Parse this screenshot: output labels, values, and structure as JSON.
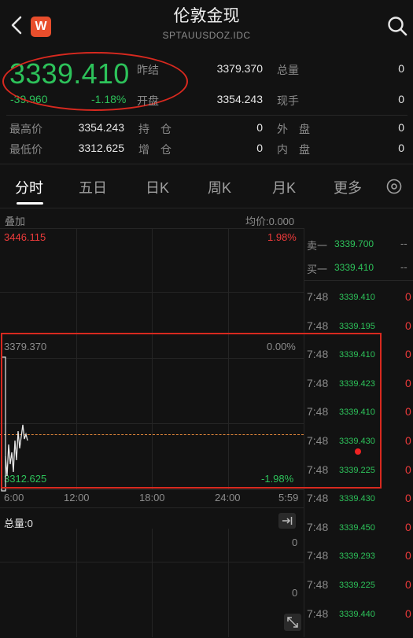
{
  "header": {
    "title": "伦敦金现",
    "subtitle": "SPTAUUSDOZ.IDC",
    "logo_letter": "W"
  },
  "quote": {
    "price": "3339.410",
    "change": "-39.960",
    "change_pct": "-1.18%",
    "fields": [
      {
        "label": "昨结",
        "value": "3379.370"
      },
      {
        "label": "总量",
        "value": "0"
      },
      {
        "label": "开盘",
        "value": "3354.243"
      },
      {
        "label": "现手",
        "value": "0"
      },
      {
        "label": "最高价",
        "value": "3354.243"
      },
      {
        "label": "持　仓",
        "value": "0"
      },
      {
        "label": "外　盘",
        "value": "0"
      },
      {
        "label": "最低价",
        "value": "3312.625"
      },
      {
        "label": "增　仓",
        "value": "0"
      },
      {
        "label": "内　盘",
        "value": "0"
      }
    ]
  },
  "tabs": [
    "分时",
    "五日",
    "日K",
    "周K",
    "月K",
    "更多"
  ],
  "chart": {
    "overlay_label": "叠加",
    "avg_label": "均价:0.000",
    "high": "3446.115",
    "high_pct": "1.98%",
    "ref": "3379.370",
    "ref_pct": "0.00%",
    "low": "3312.625",
    "low_pct": "-1.98%",
    "times": [
      "6:00",
      "12:00",
      "18:00",
      "24:00",
      "5:59"
    ],
    "volume_label": "总量:0",
    "vol_max": "0",
    "vol_min": "0"
  },
  "orderbook": {
    "sell_label": "卖一",
    "sell_price": "3339.700",
    "sell_vol": "--",
    "buy_label": "买一",
    "buy_price": "3339.410",
    "buy_vol": "--"
  },
  "trades": [
    {
      "time": "7:48",
      "price": "3339.410",
      "vol": "0"
    },
    {
      "time": "7:48",
      "price": "3339.195",
      "vol": "0"
    },
    {
      "time": "7:48",
      "price": "3339.410",
      "vol": "0"
    },
    {
      "time": "7:48",
      "price": "3339.423",
      "vol": "0"
    },
    {
      "time": "7:48",
      "price": "3339.410",
      "vol": "0"
    },
    {
      "time": "7:48",
      "price": "3339.430",
      "vol": "0"
    },
    {
      "time": "7:48",
      "price": "3339.225",
      "vol": "0"
    },
    {
      "time": "7:48",
      "price": "3339.430",
      "vol": "0"
    },
    {
      "time": "7:48",
      "price": "3339.450",
      "vol": "0"
    },
    {
      "time": "7:48",
      "price": "3339.293",
      "vol": "0"
    },
    {
      "time": "7:48",
      "price": "3339.225",
      "vol": "0"
    },
    {
      "time": "7:48",
      "price": "3339.440",
      "vol": "0"
    }
  ],
  "colors": {
    "background": "#121212",
    "up": "#ee3b3b",
    "down": "#2dc25a",
    "brand": "#e84e2c",
    "annotation": "#d8291f"
  }
}
